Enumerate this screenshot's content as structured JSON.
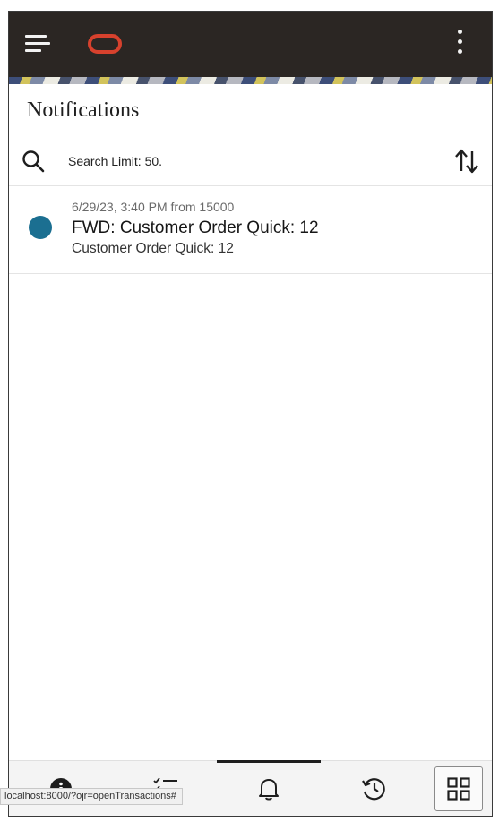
{
  "header": {
    "menu_icon": "hamburger-menu-icon",
    "logo_icon": "oracle-logo",
    "overflow_icon": "more-vertical-icon",
    "brand_color": "#d7412d",
    "bar_color": "#2b2623"
  },
  "page": {
    "title": "Notifications"
  },
  "toolbar": {
    "search_icon": "search-icon",
    "search_limit_text": "Search Limit: 50.",
    "sort_icon": "sort-arrows-icon"
  },
  "notifications": [
    {
      "timestamp": "6/29/23, 3:40 PM from 15000",
      "title": "FWD: Customer Order Quick: 12",
      "subtitle": "Customer Order Quick: 12",
      "unread_dot_color": "#1b6f91"
    }
  ],
  "bottom_nav": {
    "items": [
      {
        "icon": "info-icon"
      },
      {
        "icon": "checklist-icon"
      },
      {
        "icon": "bell-icon",
        "active": true
      },
      {
        "icon": "history-icon"
      },
      {
        "icon": "grid-icon"
      }
    ]
  },
  "status_bar": {
    "url": "localhost:8000/?ojr=openTransactions#"
  }
}
